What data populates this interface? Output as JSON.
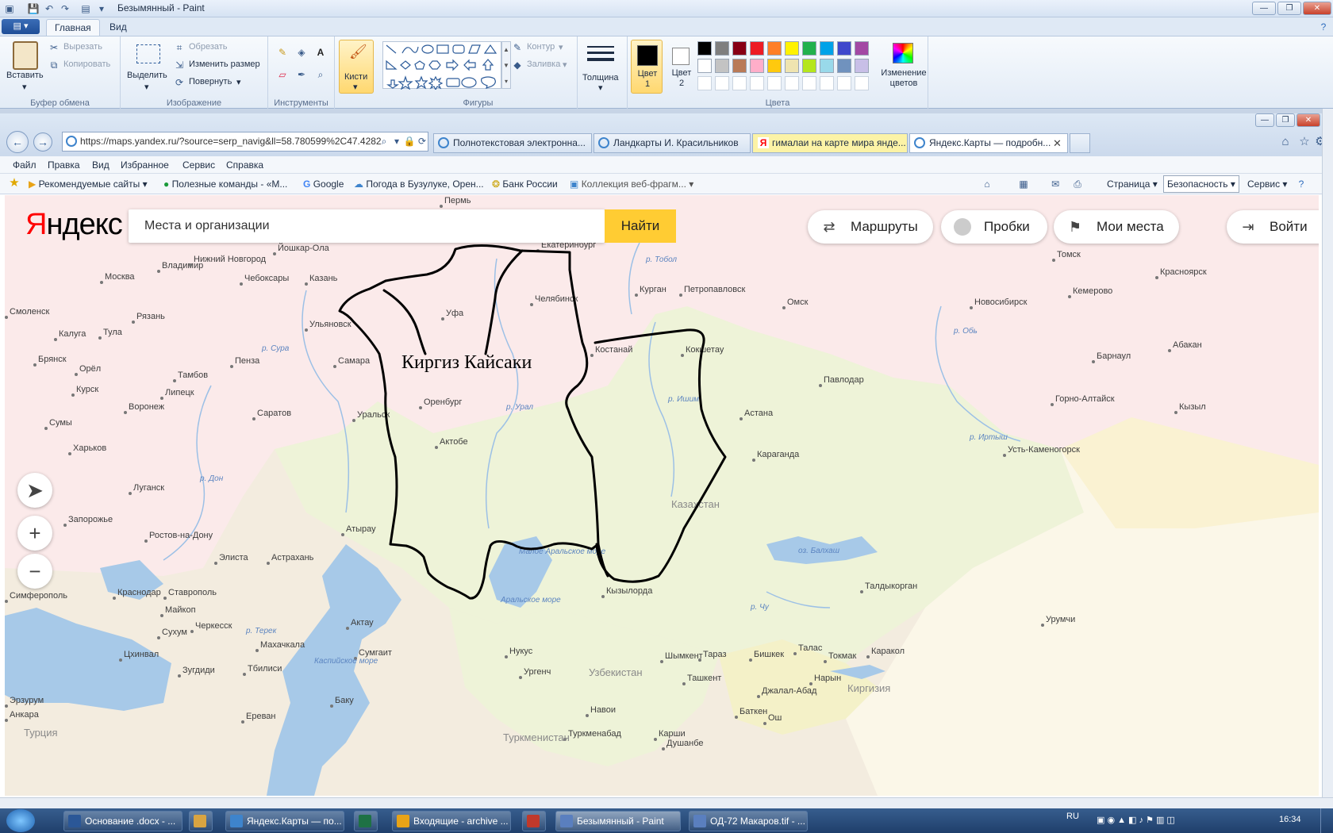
{
  "paint": {
    "window_title": "Безымянный - Paint",
    "tabs": [
      "Главная",
      "Вид"
    ],
    "clipboard": {
      "paste": "Вставить",
      "cut": "Вырезать",
      "copy": "Копировать",
      "group": "Буфер обмена"
    },
    "image": {
      "select": "Выделить",
      "crop": "Обрезать",
      "resize": "Изменить размер",
      "rotate": "Повернуть",
      "group": "Изображение"
    },
    "tools": {
      "group": "Инструменты"
    },
    "brushes": "Кисти",
    "shapes": {
      "outline": "Контур",
      "fill": "Заливка",
      "group": "Фигуры"
    },
    "size": "Толщина",
    "color1": "Цвет 1",
    "color2": "Цвет 2",
    "edit_colors": "Изменение цветов",
    "colors_group": "Цвета",
    "palette_row1": [
      "#000000",
      "#7f7f7f",
      "#880015",
      "#ed1c24",
      "#ff7f27",
      "#fff200",
      "#22b14c",
      "#00a2e8",
      "#3f48cc",
      "#a349a4"
    ],
    "palette_row2": [
      "#ffffff",
      "#c3c3c3",
      "#b97a57",
      "#ffaec9",
      "#ffc90e",
      "#efe4b0",
      "#b5e61d",
      "#99d9ea",
      "#7092be",
      "#c8bfe7"
    ]
  },
  "browser": {
    "address": "https://maps.yandex.ru/?source=serp_navig&ll=58.780599%2C47.4282",
    "tabs": [
      {
        "label": "Полнотекстовая электронна...",
        "state": "normal"
      },
      {
        "label": "Ландкарты И. Красильников",
        "state": "normal"
      },
      {
        "label": "гималаи на карте мира янде...",
        "state": "yandex"
      },
      {
        "label": "Яндекс.Карты — подробн...",
        "state": "active"
      }
    ],
    "menu": [
      "Файл",
      "Правка",
      "Вид",
      "Избранное",
      "Сервис",
      "Справка"
    ],
    "favorites": [
      "Рекомендуемые сайты",
      "Полезные команды - «М...",
      "Google",
      "Погода в Бузулуке, Орен...",
      "Банк России",
      "Коллекция веб-фрагм..."
    ],
    "commands": {
      "page": "Страница",
      "safety": "Безопасность",
      "service": "Сервис"
    }
  },
  "yandex": {
    "logo_y": "Я",
    "logo_rest": "ндекс",
    "search_placeholder": "Места и организации",
    "find": "Найти",
    "routes": "Маршруты",
    "traffic": "Пробки",
    "my_places": "Мои места",
    "login": "Войти"
  },
  "map": {
    "annotation": "Киргиз Кайсаки",
    "country_kz": "Казахстан",
    "country_uz": "Узбекистан",
    "country_tm": "Туркменистан",
    "country_kg": "Киргизия",
    "country_tr": "Турция",
    "aral_small": "Малое Аральское море",
    "aral": "Аральское море",
    "caspian": "Каспийское море",
    "balkhash": "оз. Балхаш",
    "cities": [
      {
        "name": "Москва"
      },
      {
        "name": "Владимир"
      },
      {
        "name": "Нижний Новгород"
      },
      {
        "name": "Йошкар-Ола"
      },
      {
        "name": "Чебоксары"
      },
      {
        "name": "Казань"
      },
      {
        "name": "Ульяновск"
      },
      {
        "name": "Самара"
      },
      {
        "name": "Уфа"
      },
      {
        "name": "Челябинск"
      },
      {
        "name": "Екатеринбург"
      },
      {
        "name": "Пермь"
      },
      {
        "name": "Курган"
      },
      {
        "name": "Петропавловск"
      },
      {
        "name": "Омск"
      },
      {
        "name": "Новосибирск"
      },
      {
        "name": "Томск"
      },
      {
        "name": "Кемерово"
      },
      {
        "name": "Красноярск"
      },
      {
        "name": "Барнаул"
      },
      {
        "name": "Абакан"
      },
      {
        "name": "Костанай"
      },
      {
        "name": "Кокшетау"
      },
      {
        "name": "Павлодар"
      },
      {
        "name": "Астана"
      },
      {
        "name": "Караганда"
      },
      {
        "name": "Горно-Алтайск"
      },
      {
        "name": "Кызыл"
      },
      {
        "name": "Усть-Каменогорск"
      },
      {
        "name": "Оренбург"
      },
      {
        "name": "Уральск"
      },
      {
        "name": "Актобе"
      },
      {
        "name": "Саратов"
      },
      {
        "name": "Пенза"
      },
      {
        "name": "Тамбов"
      },
      {
        "name": "Липецк"
      },
      {
        "name": "Воронеж"
      },
      {
        "name": "Рязань"
      },
      {
        "name": "Тула"
      },
      {
        "name": "Калуга"
      },
      {
        "name": "Смоленск"
      },
      {
        "name": "Брянск"
      },
      {
        "name": "Орёл"
      },
      {
        "name": "Курск"
      },
      {
        "name": "Сумы"
      },
      {
        "name": "Харьков"
      },
      {
        "name": "Луганск"
      },
      {
        "name": "Запорожье"
      },
      {
        "name": "Ростов-на-Дону"
      },
      {
        "name": "Элиста"
      },
      {
        "name": "Астрахань"
      },
      {
        "name": "Атырау"
      },
      {
        "name": "Краснодар"
      },
      {
        "name": "Ставрополь"
      },
      {
        "name": "Симферополь"
      },
      {
        "name": "Майкоп"
      },
      {
        "name": "Черкесск"
      },
      {
        "name": "Сухум"
      },
      {
        "name": "Цхинвал"
      },
      {
        "name": "Зугдиди"
      },
      {
        "name": "Тбилиси"
      },
      {
        "name": "Махачкала"
      },
      {
        "name": "Актау"
      },
      {
        "name": "Баку"
      },
      {
        "name": "Ереван"
      },
      {
        "name": "Анкара"
      },
      {
        "name": "Кызылорда"
      },
      {
        "name": "Нукус"
      },
      {
        "name": "Ургенч"
      },
      {
        "name": "Туркменабад"
      },
      {
        "name": "Навои"
      },
      {
        "name": "Карши"
      },
      {
        "name": "Душанбе"
      },
      {
        "name": "Ташкент"
      },
      {
        "name": "Шымкент"
      },
      {
        "name": "Тараз"
      },
      {
        "name": "Бишкек"
      },
      {
        "name": "Талас"
      },
      {
        "name": "Токмак"
      },
      {
        "name": "Каракол"
      },
      {
        "name": "Нарын"
      },
      {
        "name": "Джалал-Абад"
      },
      {
        "name": "Баткен"
      },
      {
        "name": "Ош"
      },
      {
        "name": "Талдыкорган"
      },
      {
        "name": "Урумчи"
      },
      {
        "name": "Сумгаит"
      },
      {
        "name": "Эрзурум"
      }
    ],
    "rivers": [
      "р. Урал",
      "р. Ишим",
      "р. Тобол",
      "р. Обь",
      "р. Дон",
      "р. Сура",
      "р. Чу",
      "р. Терек",
      "р. Иртыш"
    ]
  },
  "taskbar": {
    "items": [
      {
        "label": "Основание .docx - ...",
        "color": "#2b5797"
      },
      {
        "label": "",
        "color": "#d9a441"
      },
      {
        "label": "Яндекс.Карты — по...",
        "color": "#3e84cc"
      },
      {
        "label": "",
        "color": "#1e7145"
      },
      {
        "label": "Входящие - archive ...",
        "color": "#e8a317"
      },
      {
        "label": "",
        "color": "#c0392b"
      },
      {
        "label": "Безымянный - Paint",
        "color": "#5a7fbf"
      },
      {
        "label": "ОД-72 Макаров.tif - ...",
        "color": "#5a7fbf"
      }
    ],
    "lang": "RU",
    "time": "16:34"
  }
}
